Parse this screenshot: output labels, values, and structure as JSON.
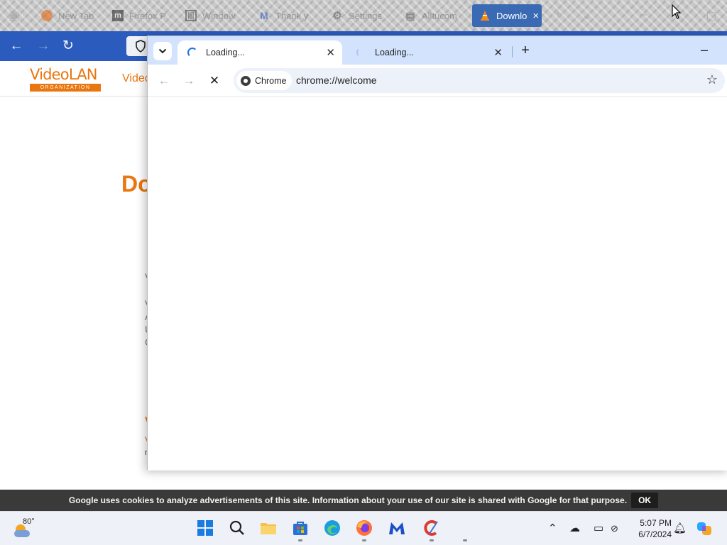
{
  "firefox": {
    "tabs": [
      {
        "title": "New Tab"
      },
      {
        "title": "Firefox P"
      },
      {
        "title": "Window"
      },
      {
        "title": "Thank y"
      },
      {
        "title": "Settings"
      },
      {
        "title": "Alltucom"
      },
      {
        "title": "Downlo",
        "active": true
      }
    ]
  },
  "vlc_page": {
    "logo_main": "VideoLAN",
    "logo_sub": "ORGANIZATION",
    "nav_first": "Videc",
    "heading_fragment": "Do",
    "fragments": [
      "V",
      "V",
      "A",
      "U",
      "C",
      "V",
      "V",
      "n"
    ]
  },
  "chrome": {
    "tabs": [
      {
        "title": "Loading...",
        "active": true
      },
      {
        "title": "Loading...",
        "active": false
      }
    ],
    "chip_label": "Chrome",
    "url": "chrome://welcome"
  },
  "cookie_banner": {
    "text": "Google uses cookies to analyze advertisements of this site. Information about your use of our site is shared with Google for that purpose.",
    "button": "OK"
  },
  "taskbar": {
    "weather_temp": "80°",
    "time": "5:07 PM",
    "date": "6/7/2024"
  },
  "colors": {
    "vlc_orange": "#e9760f",
    "firefox_blue": "#2a5bbd",
    "chrome_tabstrip": "#d3e3fd",
    "chrome_omnibox": "#edf2fa"
  }
}
